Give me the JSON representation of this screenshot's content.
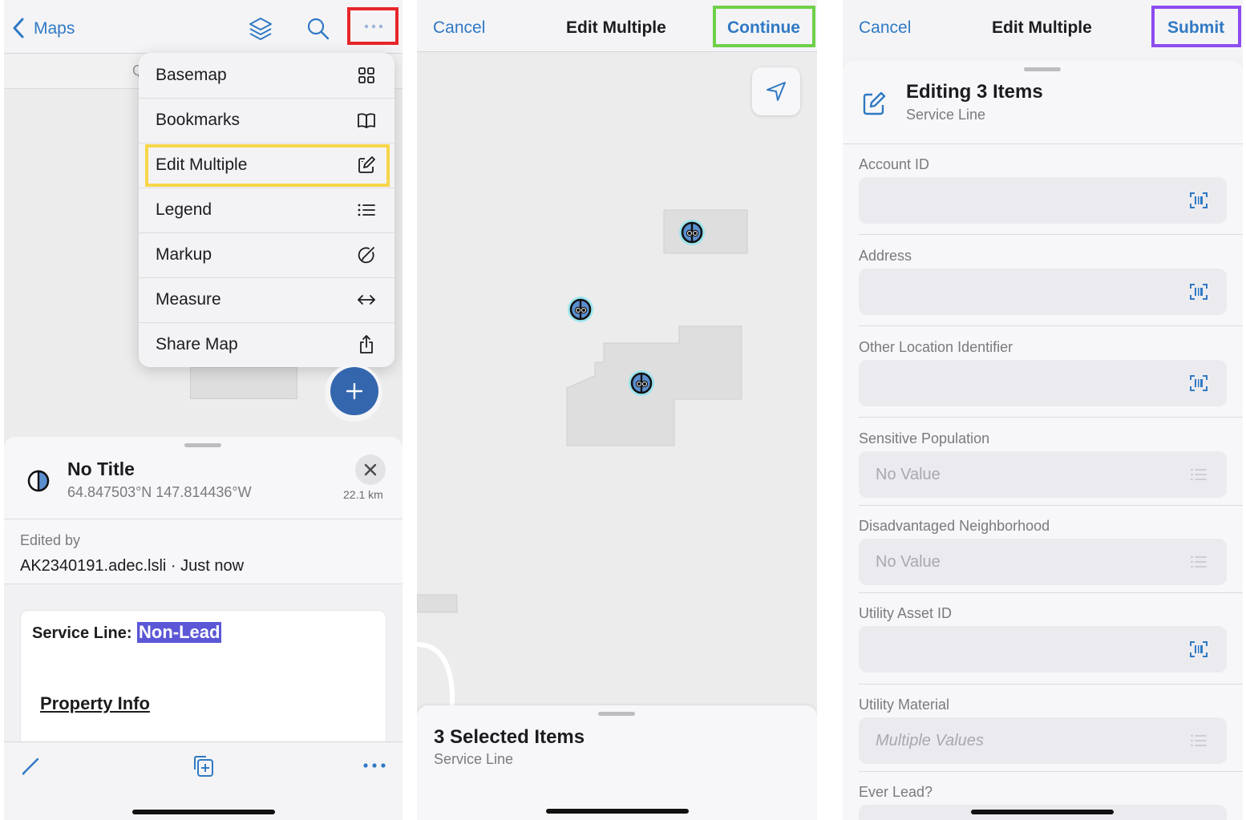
{
  "colors": {
    "accent": "#2f79c4",
    "highlight_red": "#e8262a",
    "highlight_yellow": "#f7d54a",
    "highlight_green": "#6fd04a",
    "highlight_purple": "#8e4cf0",
    "selection_bg": "#5b57d6",
    "fab": "#3466ad"
  },
  "screen1": {
    "nav": {
      "back_label": "Maps",
      "icons": [
        "layers-icon",
        "search-icon",
        "more-icon"
      ]
    },
    "search_placeholder_fragment": "Q",
    "menu": {
      "items": [
        {
          "label": "Basemap",
          "icon": "grid-icon"
        },
        {
          "label": "Bookmarks",
          "icon": "book-icon"
        },
        {
          "label": "Edit Multiple",
          "icon": "edit-square-icon"
        },
        {
          "label": "Legend",
          "icon": "list-icon"
        },
        {
          "label": "Markup",
          "icon": "markup-icon"
        },
        {
          "label": "Measure",
          "icon": "arrows-horizontal-icon"
        },
        {
          "label": "Share Map",
          "icon": "share-icon"
        }
      ]
    },
    "fab_icon": "plus-icon",
    "feature": {
      "title": "No Title",
      "coords": "64.847503°N 147.814436°W",
      "distance": "22.1 km",
      "edited_label": "Edited by",
      "edited_value": "AK2340191.adec.lsli · Just now"
    },
    "popup": {
      "service_line_label": "Service Line:",
      "service_line_value": "Non-Lead",
      "property_info": "Property Info"
    },
    "toolbar_icons": [
      "pencil-icon",
      "add-copy-icon",
      "more-icon"
    ]
  },
  "screen2": {
    "nav": {
      "cancel": "Cancel",
      "title": "Edit Multiple",
      "continue": "Continue"
    },
    "selection": {
      "title": "3 Selected Items",
      "subtitle": "Service Line"
    }
  },
  "screen3": {
    "nav": {
      "cancel": "Cancel",
      "title": "Edit Multiple",
      "submit": "Submit"
    },
    "header": {
      "title": "Editing 3 Items",
      "subtitle": "Service Line"
    },
    "fields": [
      {
        "label": "Account ID",
        "value": "",
        "kind": "scan"
      },
      {
        "label": "Address",
        "value": "",
        "kind": "scan"
      },
      {
        "label": "Other Location Identifier",
        "value": "",
        "kind": "scan"
      },
      {
        "label": "Sensitive Population",
        "value": "No Value",
        "kind": "list"
      },
      {
        "label": "Disadvantaged Neighborhood",
        "value": "No Value",
        "kind": "list"
      },
      {
        "label": "Utility Asset ID",
        "value": "",
        "kind": "scan"
      },
      {
        "label": "Utility Material",
        "value": "Multiple Values",
        "kind": "list-italic"
      },
      {
        "label": "Ever Lead?",
        "value": "",
        "kind": "list"
      }
    ]
  }
}
